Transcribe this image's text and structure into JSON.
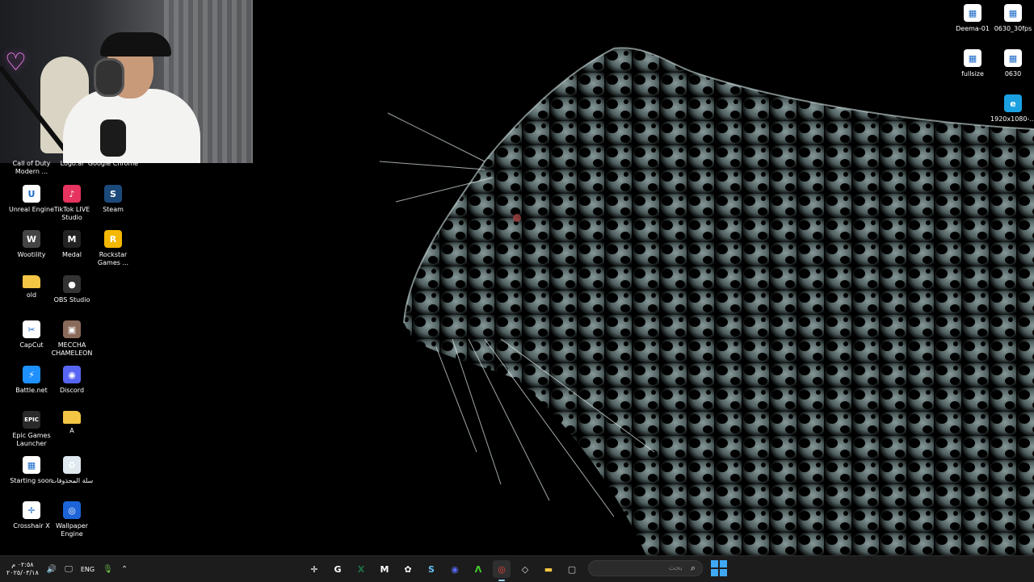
{
  "desktop": {
    "left_partial_labels": [
      "Call of Duty Modern ...",
      "Logo.ai",
      "Google Chrome"
    ],
    "left_icons": [
      {
        "label": "Unreal Engine",
        "icon": "unreal-icon",
        "color": "#ffffff",
        "glyph": "U"
      },
      {
        "label": "TikTok LIVE Studio",
        "icon": "tiktok-icon",
        "color": "#e6335f",
        "glyph": "♪"
      },
      {
        "label": "Steam",
        "icon": "steam-icon",
        "color": "#1b4a7a",
        "glyph": "S"
      },
      {
        "label": "Wootility",
        "icon": "wootility-icon",
        "color": "#444444",
        "glyph": "W"
      },
      {
        "label": "Medal",
        "icon": "medal-icon",
        "color": "#222222",
        "glyph": "M"
      },
      {
        "label": "Rockstar Games ...",
        "icon": "rockstar-icon",
        "color": "#f5b800",
        "glyph": "R"
      },
      {
        "label": "old",
        "icon": "folder-icon",
        "color": "#f3c545",
        "glyph": ""
      },
      {
        "label": "OBS Studio",
        "icon": "obs-icon",
        "color": "#333333",
        "glyph": "●"
      },
      {
        "label": "CapCut",
        "icon": "capcut-icon",
        "color": "#ffffff",
        "glyph": "✂"
      },
      {
        "label": "MECCHA CHAMELEON",
        "icon": "meccha-icon",
        "color": "#8a6a5a",
        "glyph": "▣"
      },
      {
        "label": "Battle.net",
        "icon": "battlenet-icon",
        "color": "#1e90ff",
        "glyph": "⚡"
      },
      {
        "label": "Discord",
        "icon": "discord-icon",
        "color": "#5865f2",
        "glyph": "◉"
      },
      {
        "label": "Epic Games Launcher",
        "icon": "epic-icon",
        "color": "#2a2a2a",
        "glyph": "EPIC"
      },
      {
        "label": "A",
        "icon": "folder-icon",
        "color": "#f3c545",
        "glyph": ""
      },
      {
        "label": "Starting soon",
        "icon": "image-file-icon",
        "color": "#ffffff",
        "glyph": "▦"
      },
      {
        "label": "سلة المحذوفات",
        "icon": "recycle-bin-icon",
        "color": "#dfe8ee",
        "glyph": "♻"
      },
      {
        "label": "Crosshair X",
        "icon": "crosshair-icon",
        "color": "#ffffff",
        "glyph": "✛"
      },
      {
        "label": "Wallpaper Engine",
        "icon": "wallpaper-engine-icon",
        "color": "#1c64d8",
        "glyph": "◎"
      }
    ],
    "right_icons": [
      {
        "label": "Deema-01",
        "icon": "image-file-icon",
        "color": "#ffffff",
        "glyph": "▦"
      },
      {
        "label": "0630_30fps",
        "icon": "image-file-icon",
        "color": "#ffffff",
        "glyph": "▦"
      },
      {
        "label": "fullsize",
        "icon": "image-file-icon",
        "color": "#ffffff",
        "glyph": "▦"
      },
      {
        "label": "0630",
        "icon": "image-file-icon",
        "color": "#ffffff",
        "glyph": "▦"
      },
      {
        "label": "1920x1080-...",
        "icon": "edge-icon",
        "color": "#1ba1e2",
        "glyph": "e"
      }
    ]
  },
  "taskbar": {
    "clock_time": "٠٢:٥٨ م",
    "clock_date": "٢٠٢٥/٠٣/١٨",
    "language": "ENG",
    "search_placeholder": "بحث",
    "apps": [
      {
        "name": "crosshair",
        "icon": "crosshair-icon",
        "color": "#ffffff",
        "glyph": "✛",
        "active": false
      },
      {
        "name": "logitech",
        "icon": "logitech-icon",
        "color": "#ffffff",
        "glyph": "G",
        "active": false
      },
      {
        "name": "excel",
        "icon": "excel-icon",
        "color": "#1e7145",
        "glyph": "X",
        "active": false
      },
      {
        "name": "medal",
        "icon": "medal-icon",
        "color": "#ffffff",
        "glyph": "M",
        "active": false
      },
      {
        "name": "davinci",
        "icon": "davinci-icon",
        "color": "#ffffff",
        "glyph": "✿",
        "active": false
      },
      {
        "name": "steam",
        "icon": "steam-icon",
        "color": "#66c0f4",
        "glyph": "S",
        "active": false
      },
      {
        "name": "discord",
        "icon": "discord-icon",
        "color": "#5865f2",
        "glyph": "◉",
        "active": false
      },
      {
        "name": "razer",
        "icon": "razer-icon",
        "color": "#44d62c",
        "glyph": "Λ",
        "active": false
      },
      {
        "name": "chrome",
        "icon": "chrome-icon",
        "color": "#ea4335",
        "glyph": "◎",
        "active": true
      },
      {
        "name": "unity",
        "icon": "unity-icon",
        "color": "#dddddd",
        "glyph": "◇",
        "active": false
      },
      {
        "name": "file-explorer",
        "icon": "folder-icon",
        "color": "#f3c545",
        "glyph": "▬",
        "active": false
      },
      {
        "name": "windows-app",
        "icon": "window-icon",
        "color": "#cccccc",
        "glyph": "▢",
        "active": false
      }
    ]
  }
}
